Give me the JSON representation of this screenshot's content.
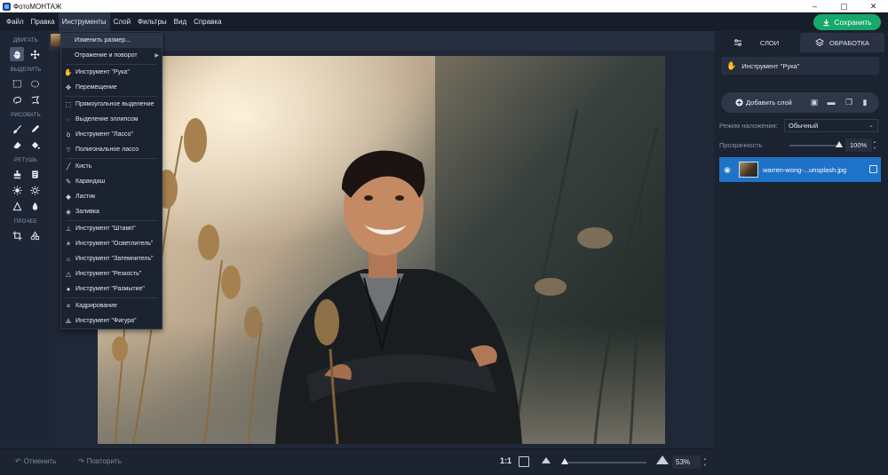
{
  "window": {
    "title": "ФотоМОНТАЖ",
    "controls": [
      "–",
      "▢",
      "✕"
    ]
  },
  "menubar": {
    "items": [
      "Файл",
      "Правка",
      "Инструменты",
      "Слой",
      "Фильтры",
      "Вид",
      "Справка"
    ],
    "active": "Инструменты",
    "save_label": "Сохранить",
    "save_color": "#17a86b"
  },
  "toolbar": {
    "groups": [
      {
        "label": "ДВИГАТЬ",
        "tools": [
          "hand-icon",
          "move-icon"
        ]
      },
      {
        "label": "ВЫДЕЛИТЬ",
        "tools": [
          "rect-select-icon",
          "ellipse-select-icon",
          "lasso-icon",
          "poly-lasso-icon"
        ]
      },
      {
        "label": "РИСОВАТЬ",
        "tools": [
          "brush-icon",
          "pencil-icon",
          "eraser-icon",
          "fill-icon"
        ]
      },
      {
        "label": "РЕТУШЬ",
        "tools": [
          "stamp-icon",
          "dodge-icon",
          "burn-icon",
          "sharpen-icon",
          "sharpen-triangle-icon",
          "blur-icon"
        ]
      },
      {
        "label": "ПРОЧЕЕ",
        "tools": [
          "crop-icon",
          "shape-icon"
        ]
      }
    ]
  },
  "dropdown": {
    "items": [
      {
        "label": "Изменить размер...",
        "icon": "",
        "highlight": true
      },
      {
        "label": "Отражение и поворот",
        "icon": "",
        "submenu": true
      },
      {
        "label": "Инструмент \"Рука\"",
        "icon": "hand-icon"
      },
      {
        "label": "Перемещение",
        "icon": "move-icon"
      },
      {
        "label": "Прямоугольное выделение",
        "icon": "rect-select-icon"
      },
      {
        "label": "Выделение эллипсом",
        "icon": "ellipse-select-icon"
      },
      {
        "label": "Инструмент \"Лассо\"",
        "icon": "lasso-icon"
      },
      {
        "label": "Полигональное лассо",
        "icon": "poly-lasso-icon"
      },
      {
        "label": "Кисть",
        "icon": "brush-icon"
      },
      {
        "label": "Карандаш",
        "icon": "pencil-icon"
      },
      {
        "label": "Ластик",
        "icon": "eraser-icon"
      },
      {
        "label": "Заливка",
        "icon": "fill-icon"
      },
      {
        "label": "Инструмент \"Штамп\"",
        "icon": "stamp-icon"
      },
      {
        "label": "Инструмент \"Осветлитель\"",
        "icon": "dodge-icon"
      },
      {
        "label": "Инструмент \"Затемнитель\"",
        "icon": "burn-icon"
      },
      {
        "label": "Инструмент \"Резкость\"",
        "icon": "sharpen-icon"
      },
      {
        "label": "Инструмент \"Размытие\"",
        "icon": "blur-icon"
      },
      {
        "label": "Кадрирование",
        "icon": "crop-icon"
      },
      {
        "label": "Инструмент \"Фигура\"",
        "icon": "shape-icon"
      }
    ]
  },
  "bottombar": {
    "undo_label": "Отменить",
    "redo_label": "Повторить",
    "ratio_label": "1:1",
    "zoom_value": "53%",
    "zoom_fraction": 0.53
  },
  "rightpanel": {
    "tab_layers": "СЛОИ",
    "tab_process": "ОБРАБОТКА",
    "active_tool": "Инструмент \"Рука\"",
    "add_layer_label": "Добавить слой",
    "blend_label": "Режим наложения:",
    "blend_value": "Обычный",
    "opacity_label": "Прозрачность",
    "opacity_value": "100%",
    "opacity_fraction": 1.0,
    "layer_name": "warren-wong-...unsplash.jpg",
    "layer_color": "#1e73c8"
  }
}
